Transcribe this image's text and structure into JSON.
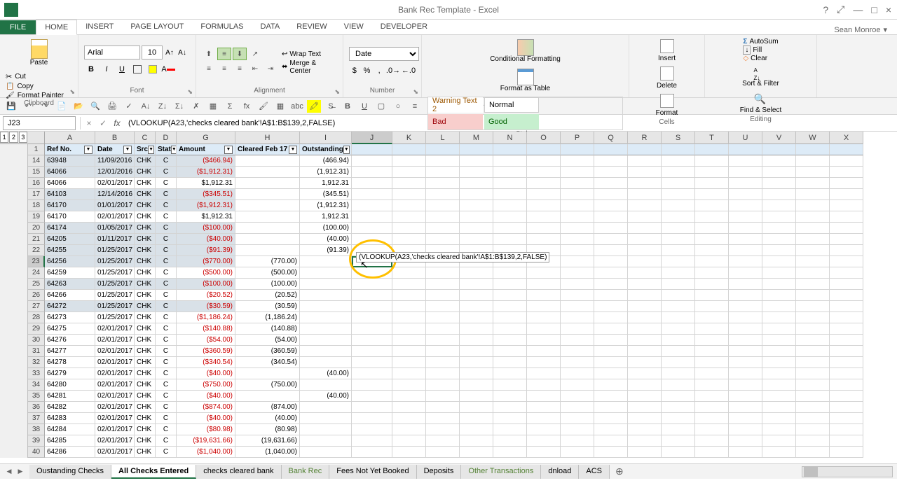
{
  "app": {
    "title": "Bank Rec Template - Excel",
    "user": "Sean Monroe"
  },
  "menu": {
    "file": "FILE",
    "tabs": [
      "HOME",
      "INSERT",
      "PAGE LAYOUT",
      "FORMULAS",
      "DATA",
      "REVIEW",
      "VIEW",
      "DEVELOPER"
    ],
    "active": 0
  },
  "ribbon": {
    "clipboard": {
      "label": "Clipboard",
      "paste": "Paste",
      "cut": "Cut",
      "copy": "Copy",
      "painter": "Format Painter"
    },
    "font": {
      "label": "Font",
      "name": "Arial",
      "size": "10"
    },
    "alignment": {
      "label": "Alignment",
      "wrap": "Wrap Text",
      "merge": "Merge & Center"
    },
    "number": {
      "label": "Number",
      "format": "Date"
    },
    "styles": {
      "label": "Styles",
      "cond": "Conditional Formatting",
      "table": "Format as Table",
      "warning": "Warning Text 2",
      "normal": "Normal",
      "bad": "Bad",
      "good": "Good"
    },
    "cells": {
      "label": "Cells",
      "insert": "Insert",
      "delete": "Delete",
      "format": "Format"
    },
    "editing": {
      "label": "Editing",
      "autosum": "AutoSum",
      "fill": "Fill",
      "clear": "Clear",
      "sort": "Sort & Filter",
      "find": "Find & Select"
    }
  },
  "formula_bar": {
    "cell_ref": "J23",
    "formula": "(VLOOKUP(A23,'checks cleared bank'!A$1:B$139,2,FALSE)"
  },
  "columns": [
    "A",
    "B",
    "C",
    "D",
    "G",
    "H",
    "I",
    "J",
    "K",
    "L",
    "M",
    "N",
    "O",
    "P",
    "Q",
    "R",
    "S",
    "T",
    "U",
    "V",
    "W",
    "X"
  ],
  "active_col": "J",
  "headers": {
    "A": "Ref No.",
    "B": "Date",
    "C": "Src",
    "D": "Stat",
    "G": "Amount",
    "H": "Cleared Feb 17",
    "I": "Outstanding"
  },
  "header_row": 1,
  "active_row": 23,
  "rows": [
    {
      "n": 14,
      "A": "63948",
      "B": "11/09/2016",
      "C": "CHK",
      "D": "C",
      "G": "($466.94)",
      "H": "",
      "I": "(466.94)",
      "sel": true,
      "gred": true
    },
    {
      "n": 15,
      "A": "64066",
      "B": "12/01/2016",
      "C": "CHK",
      "D": "C",
      "G": "($1,912.31)",
      "H": "",
      "I": "(1,912.31)",
      "sel": true,
      "gred": true
    },
    {
      "n": 16,
      "A": "64066",
      "B": "02/01/2017",
      "C": "CHK",
      "D": "C",
      "G": "$1,912.31",
      "H": "",
      "I": "1,912.31",
      "sel": false,
      "gred": false
    },
    {
      "n": 17,
      "A": "64103",
      "B": "12/14/2016",
      "C": "CHK",
      "D": "C",
      "G": "($345.51)",
      "H": "",
      "I": "(345.51)",
      "sel": true,
      "gred": true
    },
    {
      "n": 18,
      "A": "64170",
      "B": "01/01/2017",
      "C": "CHK",
      "D": "C",
      "G": "($1,912.31)",
      "H": "",
      "I": "(1,912.31)",
      "sel": true,
      "gred": true
    },
    {
      "n": 19,
      "A": "64170",
      "B": "02/01/2017",
      "C": "CHK",
      "D": "C",
      "G": "$1,912.31",
      "H": "",
      "I": "1,912.31",
      "sel": false,
      "gred": false
    },
    {
      "n": 20,
      "A": "64174",
      "B": "01/05/2017",
      "C": "CHK",
      "D": "C",
      "G": "($100.00)",
      "H": "",
      "I": "(100.00)",
      "sel": true,
      "gred": true
    },
    {
      "n": 21,
      "A": "64205",
      "B": "01/11/2017",
      "C": "CHK",
      "D": "C",
      "G": "($40.00)",
      "H": "",
      "I": "(40.00)",
      "sel": true,
      "gred": true
    },
    {
      "n": 22,
      "A": "64255",
      "B": "01/25/2017",
      "C": "CHK",
      "D": "C",
      "G": "($91.39)",
      "H": "",
      "I": "(91.39)",
      "sel": true,
      "gred": true
    },
    {
      "n": 23,
      "A": "64256",
      "B": "01/25/2017",
      "C": "CHK",
      "D": "C",
      "G": "($770.00)",
      "H": "(770.00)",
      "I": "",
      "sel": true,
      "gred": true
    },
    {
      "n": 24,
      "A": "64259",
      "B": "01/25/2017",
      "C": "CHK",
      "D": "C",
      "G": "($500.00)",
      "H": "(500.00)",
      "I": "",
      "sel": false,
      "gred": true
    },
    {
      "n": 25,
      "A": "64263",
      "B": "01/25/2017",
      "C": "CHK",
      "D": "C",
      "G": "($100.00)",
      "H": "(100.00)",
      "I": "",
      "sel": true,
      "gred": true
    },
    {
      "n": 26,
      "A": "64266",
      "B": "01/25/2017",
      "C": "CHK",
      "D": "C",
      "G": "($20.52)",
      "H": "(20.52)",
      "I": "",
      "sel": false,
      "gred": true
    },
    {
      "n": 27,
      "A": "64272",
      "B": "01/25/2017",
      "C": "CHK",
      "D": "C",
      "G": "($30.59)",
      "H": "(30.59)",
      "I": "",
      "sel": true,
      "gred": true
    },
    {
      "n": 28,
      "A": "64273",
      "B": "01/25/2017",
      "C": "CHK",
      "D": "C",
      "G": "($1,186.24)",
      "H": "(1,186.24)",
      "I": "",
      "sel": false,
      "gred": true
    },
    {
      "n": 29,
      "A": "64275",
      "B": "02/01/2017",
      "C": "CHK",
      "D": "C",
      "G": "($140.88)",
      "H": "(140.88)",
      "I": "",
      "sel": false,
      "gred": true
    },
    {
      "n": 30,
      "A": "64276",
      "B": "02/01/2017",
      "C": "CHK",
      "D": "C",
      "G": "($54.00)",
      "H": "(54.00)",
      "I": "",
      "sel": false,
      "gred": true
    },
    {
      "n": 31,
      "A": "64277",
      "B": "02/01/2017",
      "C": "CHK",
      "D": "C",
      "G": "($360.59)",
      "H": "(360.59)",
      "I": "",
      "sel": false,
      "gred": true
    },
    {
      "n": 32,
      "A": "64278",
      "B": "02/01/2017",
      "C": "CHK",
      "D": "C",
      "G": "($340.54)",
      "H": "(340.54)",
      "I": "",
      "sel": false,
      "gred": true
    },
    {
      "n": 33,
      "A": "64279",
      "B": "02/01/2017",
      "C": "CHK",
      "D": "C",
      "G": "($40.00)",
      "H": "",
      "I": "(40.00)",
      "sel": false,
      "gred": true
    },
    {
      "n": 34,
      "A": "64280",
      "B": "02/01/2017",
      "C": "CHK",
      "D": "C",
      "G": "($750.00)",
      "H": "(750.00)",
      "I": "",
      "sel": false,
      "gred": true
    },
    {
      "n": 35,
      "A": "64281",
      "B": "02/01/2017",
      "C": "CHK",
      "D": "C",
      "G": "($40.00)",
      "H": "",
      "I": "(40.00)",
      "sel": false,
      "gred": true
    },
    {
      "n": 36,
      "A": "64282",
      "B": "02/01/2017",
      "C": "CHK",
      "D": "C",
      "G": "($874.00)",
      "H": "(874.00)",
      "I": "",
      "sel": false,
      "gred": true
    },
    {
      "n": 37,
      "A": "64283",
      "B": "02/01/2017",
      "C": "CHK",
      "D": "C",
      "G": "($40.00)",
      "H": "(40.00)",
      "I": "",
      "sel": false,
      "gred": true
    },
    {
      "n": 38,
      "A": "64284",
      "B": "02/01/2017",
      "C": "CHK",
      "D": "C",
      "G": "($80.98)",
      "H": "(80.98)",
      "I": "",
      "sel": false,
      "gred": true
    },
    {
      "n": 39,
      "A": "64285",
      "B": "02/01/2017",
      "C": "CHK",
      "D": "C",
      "G": "($19,631.66)",
      "H": "(19,631.66)",
      "I": "",
      "sel": false,
      "gred": true
    },
    {
      "n": 40,
      "A": "64286",
      "B": "02/01/2017",
      "C": "CHK",
      "D": "C",
      "G": "($1,040.00)",
      "H": "(1,040.00)",
      "I": "",
      "sel": false,
      "gred": true
    }
  ],
  "tooltip": "(VLOOKUP(A23,'checks cleared bank'!A$1:B$139,2,FALSE)",
  "sheets": {
    "tabs": [
      "Oustanding Checks",
      "All Checks Entered",
      "checks cleared bank",
      "Bank Rec",
      "Fees Not Yet Booked",
      "Deposits",
      "Other Transactions",
      "dnload",
      "ACS"
    ],
    "active": 1,
    "accented": [
      3,
      6
    ]
  }
}
